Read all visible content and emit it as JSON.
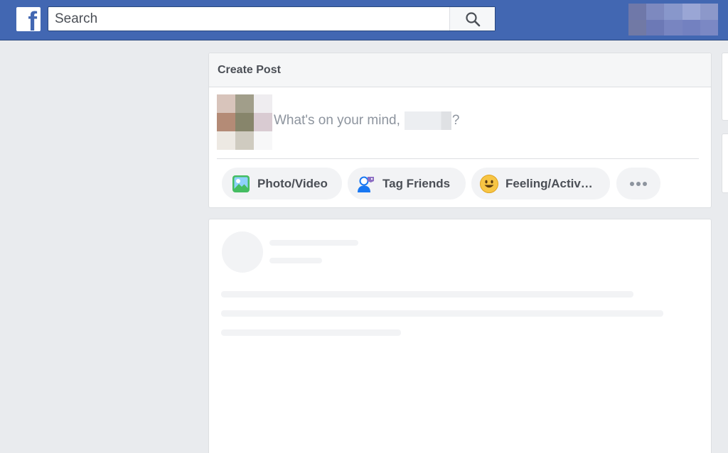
{
  "topbar": {
    "logo_letter": "f",
    "search": {
      "placeholder": "Search"
    }
  },
  "create_post": {
    "title": "Create Post",
    "prompt_prefix": "What's on your mind,",
    "prompt_suffix": "?",
    "actions": [
      {
        "label": "Photo/Video",
        "icon": "photo-video-icon"
      },
      {
        "label": "Tag Friends",
        "icon": "tag-friends-icon"
      },
      {
        "label": "Feeling/Activ…",
        "icon": "feeling-emoji-icon"
      },
      {
        "label": "",
        "icon": "more-dots-icon"
      }
    ]
  },
  "colors": {
    "brand": "#4267b2",
    "background": "#e9ebee",
    "text_secondary": "#4b4f56",
    "placeholder": "#8d949e"
  }
}
